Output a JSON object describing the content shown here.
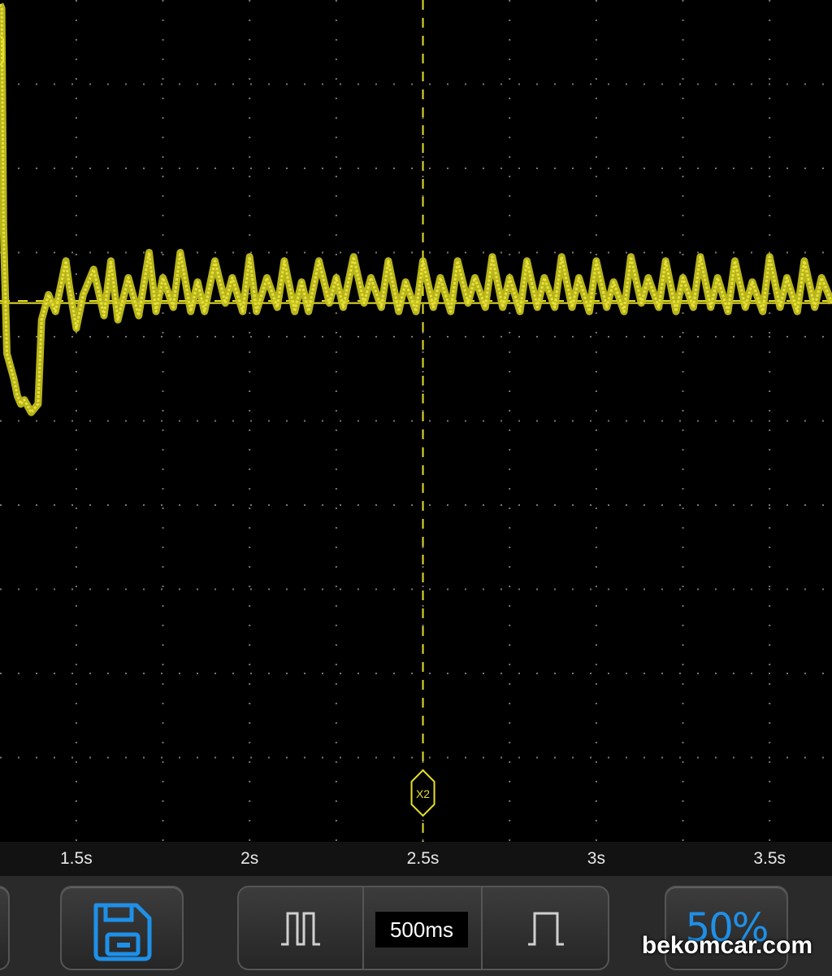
{
  "scope": {
    "trace_color": "#c8c31e",
    "cursor_color": "#e6df2a",
    "grid_color": "#777777",
    "cursor_marker_label": "X2"
  },
  "chart_data": {
    "type": "line",
    "xlabel": "",
    "ylabel": "",
    "x_ticks": [
      "1.5s",
      "2s",
      "2.5s",
      "3s",
      "3.5s"
    ],
    "x_tick_values": [
      1.5,
      2.0,
      2.5,
      3.0,
      3.5
    ],
    "xlim": [
      1.28,
      3.68
    ],
    "ylim": [
      0,
      10
    ],
    "grid": true,
    "cursors": {
      "x2": 2.5,
      "horizontal_level": 6.4
    },
    "series": [
      {
        "x": [
          1.28,
          1.285,
          1.29,
          1.3,
          1.32,
          1.33,
          1.34,
          1.35,
          1.37,
          1.39,
          1.4,
          1.42,
          1.44,
          1.46,
          1.47,
          1.48,
          1.5,
          1.52,
          1.55,
          1.58,
          1.6,
          1.62,
          1.65,
          1.68,
          1.71,
          1.73,
          1.75,
          1.78,
          1.8,
          1.83,
          1.85,
          1.87,
          1.9,
          1.93,
          1.95,
          1.98,
          2.0,
          2.02,
          2.05,
          2.08,
          2.1,
          2.13,
          2.15,
          2.17,
          2.2,
          2.23,
          2.25,
          2.27,
          2.3,
          2.33,
          2.35,
          2.38,
          2.4,
          2.43,
          2.45,
          2.48,
          2.5,
          2.53,
          2.55,
          2.58,
          2.6,
          2.63,
          2.65,
          2.68,
          2.7,
          2.73,
          2.75,
          2.78,
          2.8,
          2.83,
          2.85,
          2.88,
          2.9,
          2.93,
          2.95,
          2.98,
          3.0,
          3.03,
          3.05,
          3.08,
          3.1,
          3.13,
          3.15,
          3.18,
          3.2,
          3.23,
          3.25,
          3.28,
          3.3,
          3.33,
          3.35,
          3.38,
          3.4,
          3.43,
          3.45,
          3.48,
          3.5,
          3.53,
          3.55,
          3.58,
          3.6,
          3.63,
          3.65,
          3.68
        ],
        "y": [
          9.95,
          9.9,
          7.3,
          5.8,
          5.5,
          5.3,
          5.2,
          5.25,
          5.1,
          5.2,
          6.2,
          6.5,
          6.3,
          6.7,
          6.9,
          6.6,
          6.1,
          6.5,
          6.8,
          6.25,
          6.9,
          6.2,
          6.7,
          6.25,
          7.0,
          6.3,
          6.7,
          6.35,
          7.0,
          6.3,
          6.65,
          6.3,
          6.9,
          6.4,
          6.7,
          6.3,
          6.95,
          6.3,
          6.7,
          6.35,
          6.9,
          6.3,
          6.65,
          6.3,
          6.9,
          6.4,
          6.7,
          6.35,
          6.95,
          6.4,
          6.7,
          6.35,
          6.9,
          6.3,
          6.65,
          6.3,
          6.9,
          6.35,
          6.7,
          6.3,
          6.9,
          6.4,
          6.7,
          6.35,
          6.95,
          6.35,
          6.7,
          6.3,
          6.9,
          6.35,
          6.7,
          6.35,
          6.95,
          6.35,
          6.7,
          6.3,
          6.9,
          6.35,
          6.65,
          6.3,
          6.95,
          6.4,
          6.7,
          6.35,
          6.9,
          6.3,
          6.7,
          6.35,
          6.95,
          6.35,
          6.7,
          6.3,
          6.9,
          6.35,
          6.65,
          6.3,
          6.95,
          6.35,
          6.7,
          6.3,
          6.9,
          6.35,
          6.7,
          6.4
        ]
      }
    ]
  },
  "toolbar": {
    "timebase": "500ms",
    "trigger_level": "50%",
    "accent_color": "#1e90e8"
  },
  "watermark": "bekomcar.com"
}
